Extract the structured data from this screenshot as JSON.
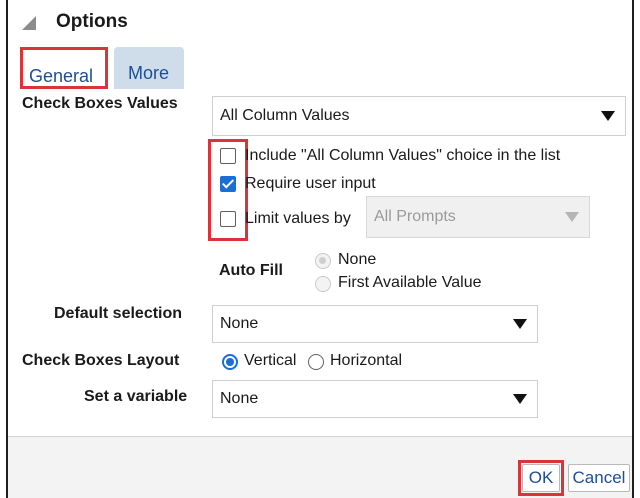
{
  "dialog": {
    "title": "Options",
    "tabs": [
      {
        "label": "General",
        "selected": true
      },
      {
        "label": "More",
        "selected": false
      }
    ]
  },
  "check_boxes_values": {
    "label": "Check Boxes Values",
    "value": "All Column Values",
    "options": [
      {
        "label": "Include \"All Column Values\" choice in the list",
        "checked": false
      },
      {
        "label": "Require user input",
        "checked": true
      },
      {
        "label": "Limit values by",
        "checked": false
      }
    ],
    "limit_by_value": "All Prompts"
  },
  "auto_fill": {
    "label": "Auto Fill",
    "options": [
      {
        "label": "None",
        "selected": true,
        "disabled": true
      },
      {
        "label": "First Available Value",
        "selected": false,
        "disabled": true
      }
    ]
  },
  "default_selection": {
    "label": "Default selection",
    "value": "None"
  },
  "layout": {
    "label": "Check Boxes Layout",
    "options": [
      {
        "label": "Vertical",
        "selected": true
      },
      {
        "label": "Horizontal",
        "selected": false
      }
    ]
  },
  "variable": {
    "label": "Set a variable",
    "value": "None"
  },
  "footer": {
    "ok_label": "OK",
    "cancel_label": "Cancel"
  },
  "colors": {
    "accent": "#1a6fd6",
    "highlight": "#d9343a",
    "tab_active_bg": "#cfdcea",
    "link": "#1d4f91"
  },
  "icons": {
    "collapse": "collapse-triangle-icon",
    "dropdown": "chevron-down-icon"
  }
}
